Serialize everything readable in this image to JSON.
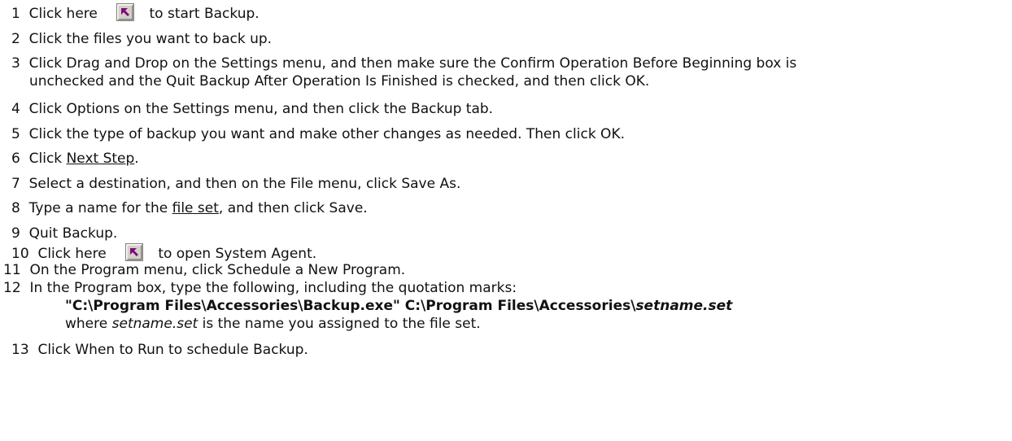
{
  "steps": [
    {
      "num": "1",
      "pre": "Click here",
      "post": "to start Backup."
    },
    {
      "num": "2",
      "text": "Click the files you want to back up."
    },
    {
      "num": "3",
      "line1": "Click Drag and Drop on the Settings menu, and then make sure the Confirm Operation Before Beginning box is",
      "line2": "unchecked and the Quit Backup After Operation Is Finished is checked, and then click OK."
    },
    {
      "num": "4",
      "text": "Click Options on the Settings menu, and then click the Backup tab."
    },
    {
      "num": "5",
      "text": "Click the type of backup you want and make other changes as needed. Then click OK."
    },
    {
      "num": "6",
      "pre": "Click ",
      "link": "Next Step",
      "post": "."
    },
    {
      "num": "7",
      "text": "Select a destination, and then on the File menu, click Save As."
    },
    {
      "num": "8",
      "pre": "Type a name for the ",
      "link": "file set",
      "post": ", and then click Save."
    },
    {
      "num": "9",
      "text": "Quit Backup."
    },
    {
      "num": "10",
      "pre": "Click here",
      "post": "to open System Agent."
    },
    {
      "num": "11",
      "text": "On the Program menu, click Schedule a New Program."
    },
    {
      "num": "12",
      "text": "In the Program box, type the following, including the quotation marks:",
      "cmd_bold": "\"C:\\Program Files\\Accessories\\Backup.exe\" C:\\Program Files\\Accessories\\",
      "cmd_bold_italic": "setname.set",
      "note_pre": "where ",
      "note_italic": "setname.set",
      "note_post": " is the name you assigned to the file set."
    },
    {
      "num": "13",
      "text": "Click When to Run to schedule Backup."
    }
  ],
  "colors": {
    "shortcut_bg": "#d4d0c8",
    "shortcut_arrow": "#7b0a7b"
  },
  "icons": {
    "shortcut": "shortcut-arrow-icon"
  }
}
